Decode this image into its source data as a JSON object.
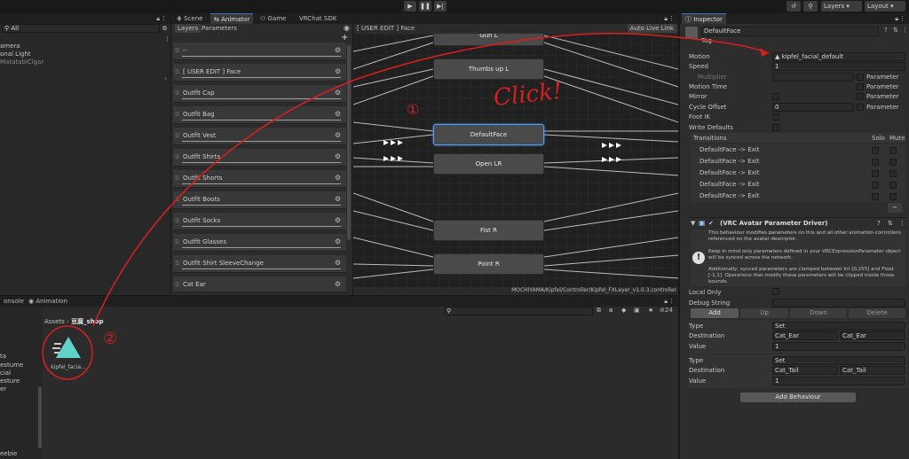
{
  "hierarchy": {
    "items": [
      "amera",
      "onal Light",
      "MatatabiCigar"
    ]
  },
  "scene_tabs": [
    {
      "label": "Scene"
    },
    {
      "label": "Animator"
    },
    {
      "label": "Game"
    },
    {
      "label": "VRChat SDK"
    }
  ],
  "animator": {
    "sub_tabs": {
      "layers": "Layers",
      "parameters": "Parameters"
    },
    "breadcrumb": "[ USER EDIT ] Face",
    "auto_live_link": "Auto Live Link",
    "layers": [
      "--",
      "[ USER EDIT ] Face",
      "Outfit Cap",
      "Outfit Bag",
      "Outfit Vest",
      "Outfit Shirts",
      "Outfit Shorts",
      "Outfit Boots",
      "Outfit Socks",
      "Outfit Glasses",
      "Outfit Shirt  SleeveChange",
      "Cat Ear"
    ],
    "states": {
      "gun": "Gun L",
      "thumbs_up": "Thumbs up L",
      "default_face": "DefaultFace",
      "open_lr": "Open LR",
      "fist": "Fist R",
      "point": "Point R"
    },
    "controller_path": "MOCHIYAMA/Kipfel/Controller/Kipfel_FXLayer_v1.0.3.controller"
  },
  "bottom_tabs": {
    "console": "onsole",
    "animation": "Animation"
  },
  "project": {
    "breadcrumb_root": "Assets",
    "breadcrumb_folder": "豆腐_shop",
    "count_badge": "24",
    "asset_label": "kipfel_facia...",
    "sidebar_items": [
      "ta",
      "estume",
      "cial",
      "esture",
      "er",
      "eebie"
    ]
  },
  "annotations": {
    "click_text": "Click!",
    "circle_1": "①",
    "circle_2": "②"
  },
  "toolbar": {
    "layers": "Layers",
    "layout": "Layout"
  },
  "inspector": {
    "tab": "Inspector",
    "object_name": "DefaultFace",
    "tag_label": "Tag",
    "motion_label": "Motion",
    "motion_value": "kipfel_facial_default",
    "speed_label": "Speed",
    "speed_value": "1",
    "multiplier_label": "Multiplier",
    "parameter_label": "Parameter",
    "motion_time_label": "Motion Time",
    "mirror_label": "Mirror",
    "cycle_offset_label": "Cycle Offset",
    "cycle_offset_value": "0",
    "foot_ik_label": "Foot IK",
    "write_defaults_label": "Write Defaults",
    "transitions_label": "Transitions",
    "solo_label": "Solo",
    "mute_label": "Mute",
    "transitions": [
      "DefaultFace -> Exit",
      "DefaultFace -> Exit",
      "DefaultFace -> Exit",
      "DefaultFace -> Exit",
      "DefaultFace -> Exit"
    ],
    "minus_label": "−",
    "component_title": "(VRC Avatar Parameter Driver)",
    "help_text_1": "This behaviour modifies parameters on this and all other animation controllers referenced on the avatar descriptor.",
    "help_text_2": "Keep in mind only parameters defined in your VRCExpressionParameter object will be synced across the network.",
    "help_text_3": "Additionally, synced parameters are clamped between Int [0,255] and Float [-1,1]. Operations that modify these parameters will be clipped inside those bounds.",
    "local_only_label": "Local Only",
    "debug_string_label": "Debug String",
    "add_btn": "Add",
    "up_btn": "Up",
    "down_btn": "Down",
    "delete_btn": "Delete",
    "entries": [
      {
        "type_label": "Type",
        "type_value": "Set",
        "dest_label": "Destination",
        "dest_value": "Cat_Ear",
        "dest_text": "Cat_Ear",
        "value_label": "Value",
        "value": "1"
      },
      {
        "type_label": "Type",
        "type_value": "Set",
        "dest_label": "Destination",
        "dest_value": "Cat_Tail",
        "dest_text": "Cat_Tail",
        "value_label": "Value",
        "value": "1"
      }
    ],
    "add_behaviour": "Add Behaviour"
  },
  "colors": {
    "annotation_red": "#d42020",
    "accent_blue": "#3a79bb",
    "asset_teal": "#5fd3c9"
  }
}
